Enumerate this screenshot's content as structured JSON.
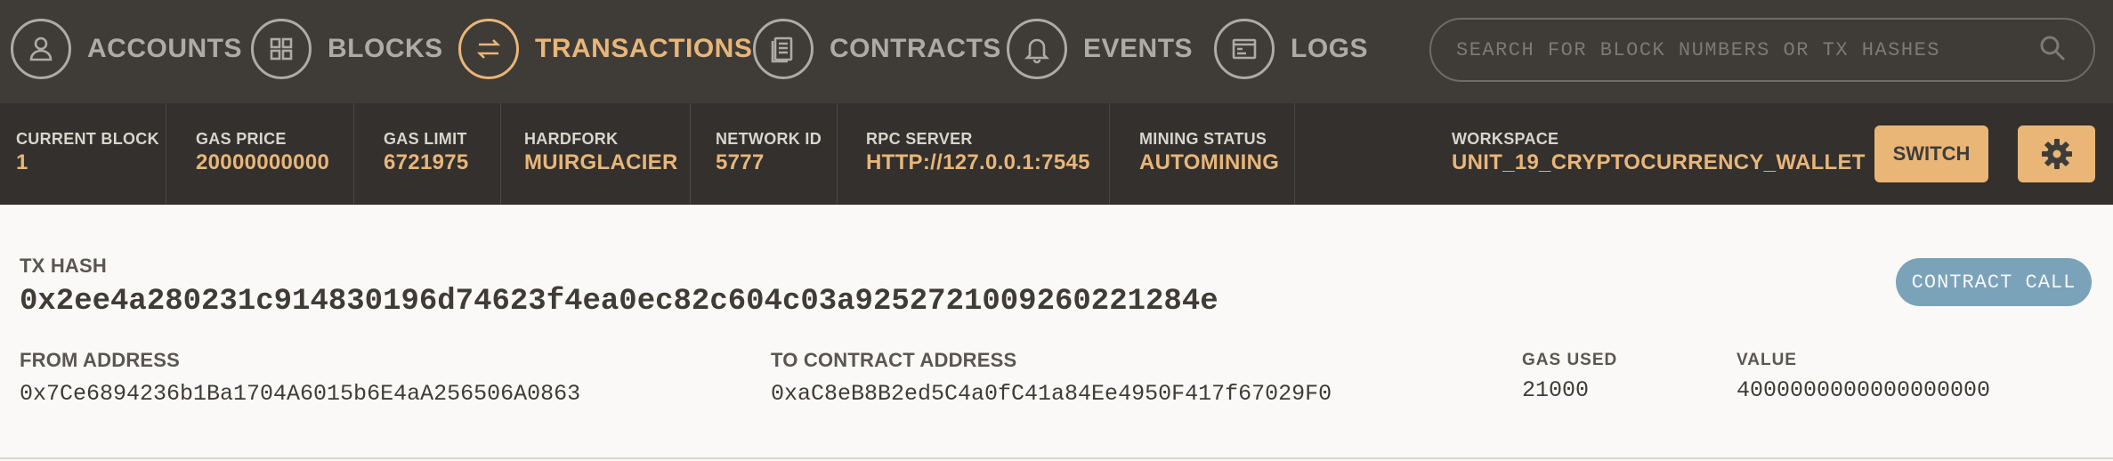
{
  "nav": {
    "items": [
      {
        "label": "ACCOUNTS",
        "icon": "account-icon",
        "active": false
      },
      {
        "label": "BLOCKS",
        "icon": "grid-icon",
        "active": false
      },
      {
        "label": "TRANSACTIONS",
        "icon": "swap-arrows-icon",
        "active": true
      },
      {
        "label": "CONTRACTS",
        "icon": "document-icon",
        "active": false
      },
      {
        "label": "EVENTS",
        "icon": "bell-icon",
        "active": false
      },
      {
        "label": "LOGS",
        "icon": "terminal-icon",
        "active": false
      }
    ],
    "search_placeholder": "SEARCH FOR BLOCK NUMBERS OR TX HASHES"
  },
  "status": {
    "current_block": {
      "label": "CURRENT BLOCK",
      "value": "1"
    },
    "gas_price": {
      "label": "GAS PRICE",
      "value": "20000000000"
    },
    "gas_limit": {
      "label": "GAS LIMIT",
      "value": "6721975"
    },
    "hardfork": {
      "label": "HARDFORK",
      "value": "MUIRGLACIER"
    },
    "network_id": {
      "label": "NETWORK ID",
      "value": "5777"
    },
    "rpc_server": {
      "label": "RPC SERVER",
      "value": "HTTP://127.0.0.1:7545"
    },
    "mining_status": {
      "label": "MINING STATUS",
      "value": "AUTOMINING"
    },
    "workspace": {
      "label": "WORKSPACE",
      "value": "UNIT_19_CRYPTOCURRENCY_WALLET"
    },
    "switch_label": "SWITCH"
  },
  "transaction": {
    "tx_hash_label": "TX HASH",
    "tx_hash": "0x2ee4a280231c914830196d74623f4ea0ec82c604c03a9252721009260221284e",
    "type_badge": "CONTRACT CALL",
    "from_label": "FROM ADDRESS",
    "from": "0x7Ce6894236b1Ba1704A6015b6E4aA256506A0863",
    "to_label": "TO CONTRACT ADDRESS",
    "to": "0xaC8eB8B2ed5C4a0fC41a84Ee4950F417f67029F0",
    "gas_used_label": "GAS USED",
    "gas_used": "21000",
    "value_label": "VALUE",
    "value": "4000000000000000000"
  },
  "colors": {
    "nav_bg": "#3f3c38",
    "status_bg": "#33302d",
    "accent": "#e9b678",
    "badge": "#7aa3b9"
  }
}
